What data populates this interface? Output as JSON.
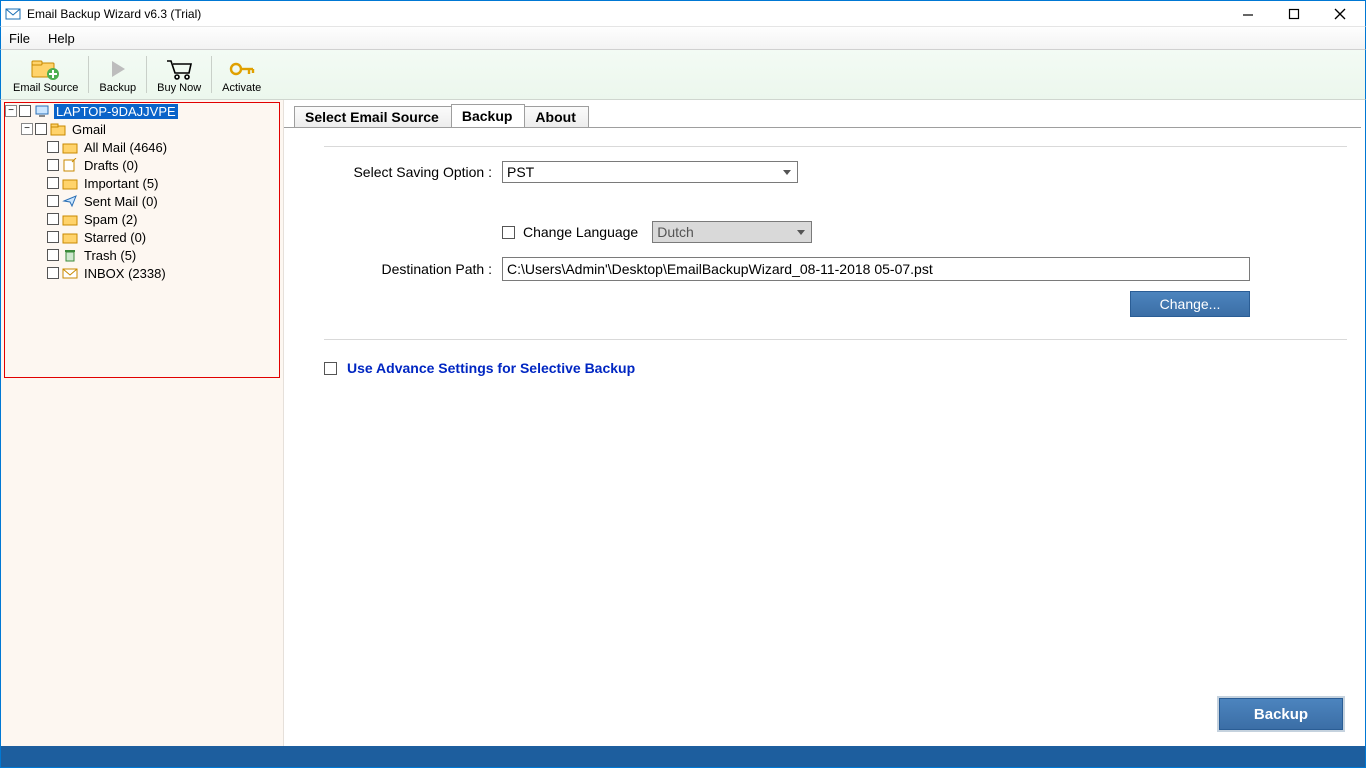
{
  "title": "Email Backup Wizard v6.3 (Trial)",
  "menu": {
    "file": "File",
    "help": "Help"
  },
  "toolbar": {
    "email_source": "Email Source",
    "backup": "Backup",
    "buy_now": "Buy Now",
    "activate": "Activate"
  },
  "tree": {
    "root": "LAPTOP-9DAJJVPE",
    "account": "Gmail",
    "folders": [
      "All Mail (4646)",
      "Drafts (0)",
      "Important (5)",
      "Sent Mail (0)",
      "Spam (2)",
      "Starred (0)",
      "Trash (5)",
      "INBOX (2338)"
    ]
  },
  "tabs": {
    "select_source": "Select Email Source",
    "backup": "Backup",
    "about": "About"
  },
  "form": {
    "saving_option_label": "Select Saving Option  :",
    "saving_option_value": "PST",
    "change_language_label": "Change Language",
    "language_value": "Dutch",
    "destination_label": "Destination Path  :",
    "destination_value": "C:\\Users\\Admin'\\Desktop\\EmailBackupWizard_08-11-2018 05-07.pst",
    "change_btn": "Change...",
    "advance_label": "Use Advance Settings for Selective Backup",
    "backup_btn": "Backup"
  }
}
